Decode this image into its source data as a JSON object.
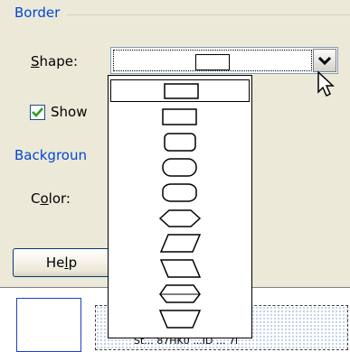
{
  "border_group": {
    "title": "Border"
  },
  "shape_field": {
    "label_prefix": "",
    "label_accel": "S",
    "label_rest": "hape:",
    "selected_value": "rectangle"
  },
  "show_checkbox": {
    "label": "Show",
    "checked": true
  },
  "background_group": {
    "title": "Backgroun"
  },
  "color_field": {
    "label_prefix": "C",
    "label_accel": "o",
    "label_rest": "lor:"
  },
  "help_button": {
    "label_prefix": "He",
    "label_accel": "l",
    "label_rest": "p"
  },
  "bottom_status": {
    "text": "St... 87HK0 ...ID ... 7i"
  },
  "dropdown": {
    "items": [
      {
        "shape": "rectangle",
        "selected": true
      },
      {
        "shape": "rectangle",
        "selected": false
      },
      {
        "shape": "rounded-rectangle",
        "selected": false
      },
      {
        "shape": "rounded-rectangle-wide",
        "selected": false
      },
      {
        "shape": "rounded-rectangle-tall",
        "selected": false
      },
      {
        "shape": "hexagon",
        "selected": false
      },
      {
        "shape": "parallelogram",
        "selected": false
      },
      {
        "shape": "parallelogram-reverse",
        "selected": false
      },
      {
        "shape": "trapezoid-pair",
        "selected": false
      },
      {
        "shape": "trapezoid",
        "selected": false
      }
    ]
  },
  "colors": {
    "accent": "#0046d5",
    "dialog_bg": "#ece9d8",
    "border": "#7f9db9"
  }
}
